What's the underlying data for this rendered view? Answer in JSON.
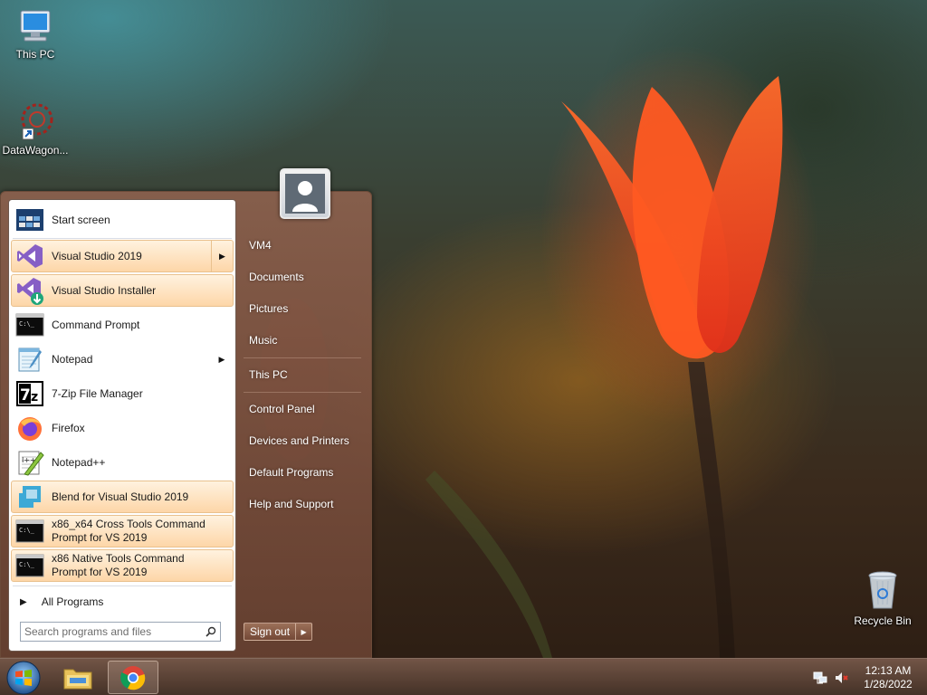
{
  "desktop": {
    "icons": [
      {
        "label": "This PC",
        "icon": "computer-icon"
      },
      {
        "label": "DataWagon...",
        "icon": "datawagon-shortcut-icon"
      },
      {
        "label": "Recycle Bin",
        "icon": "recycle-bin-icon"
      }
    ]
  },
  "start_menu": {
    "programs": [
      {
        "label": "Start screen",
        "icon": "start-screen-icon",
        "pinned": false,
        "has_submenu": false
      },
      {
        "label": "Visual Studio 2019",
        "icon": "visual-studio-icon",
        "pinned": true,
        "has_submenu": true
      },
      {
        "label": "Visual Studio Installer",
        "icon": "visual-studio-installer-icon",
        "pinned": true,
        "has_submenu": false
      },
      {
        "label": "Command Prompt",
        "icon": "command-prompt-icon",
        "pinned": false,
        "has_submenu": false
      },
      {
        "label": "Notepad",
        "icon": "notepad-icon",
        "pinned": false,
        "has_submenu": true
      },
      {
        "label": "7-Zip File Manager",
        "icon": "seven-zip-icon",
        "pinned": false,
        "has_submenu": false
      },
      {
        "label": "Firefox",
        "icon": "firefox-icon",
        "pinned": false,
        "has_submenu": false
      },
      {
        "label": "Notepad++",
        "icon": "notepad-plus-plus-icon",
        "pinned": false,
        "has_submenu": false
      },
      {
        "label": "Blend for Visual Studio 2019",
        "icon": "blend-icon",
        "pinned": true,
        "has_submenu": false
      },
      {
        "label_line1": "x86_x64 Cross Tools Command",
        "label_line2": "Prompt for VS 2019",
        "icon": "command-prompt-icon",
        "pinned": true,
        "has_submenu": false
      },
      {
        "label_line1": "x86 Native Tools Command",
        "label_line2": "Prompt for VS 2019",
        "icon": "command-prompt-icon",
        "pinned": true,
        "has_submenu": false
      }
    ],
    "all_programs_label": "All Programs",
    "search": {
      "placeholder": "Search programs and files",
      "value": ""
    },
    "right_items": {
      "user": "VM4",
      "documents": "Documents",
      "pictures": "Pictures",
      "music": "Music",
      "this_pc": "This PC",
      "control_panel": "Control Panel",
      "devices_printers": "Devices and Printers",
      "default_programs": "Default Programs",
      "help_support": "Help and Support"
    },
    "sign_out_label": "Sign out"
  },
  "taskbar": {
    "buttons": [
      {
        "icon": "start-orb-icon"
      },
      {
        "icon": "file-explorer-icon"
      },
      {
        "icon": "chrome-icon",
        "active": true
      }
    ],
    "tray": {
      "network_icon": "network-icon",
      "volume_icon": "volume-muted-icon"
    },
    "clock": {
      "time": "12:13 AM",
      "date": "1/28/2022"
    }
  },
  "colors": {
    "pinned_highlight": "#fdd6a8",
    "menu_frame": "#8a5a45",
    "taskbar": "#5d4538"
  }
}
